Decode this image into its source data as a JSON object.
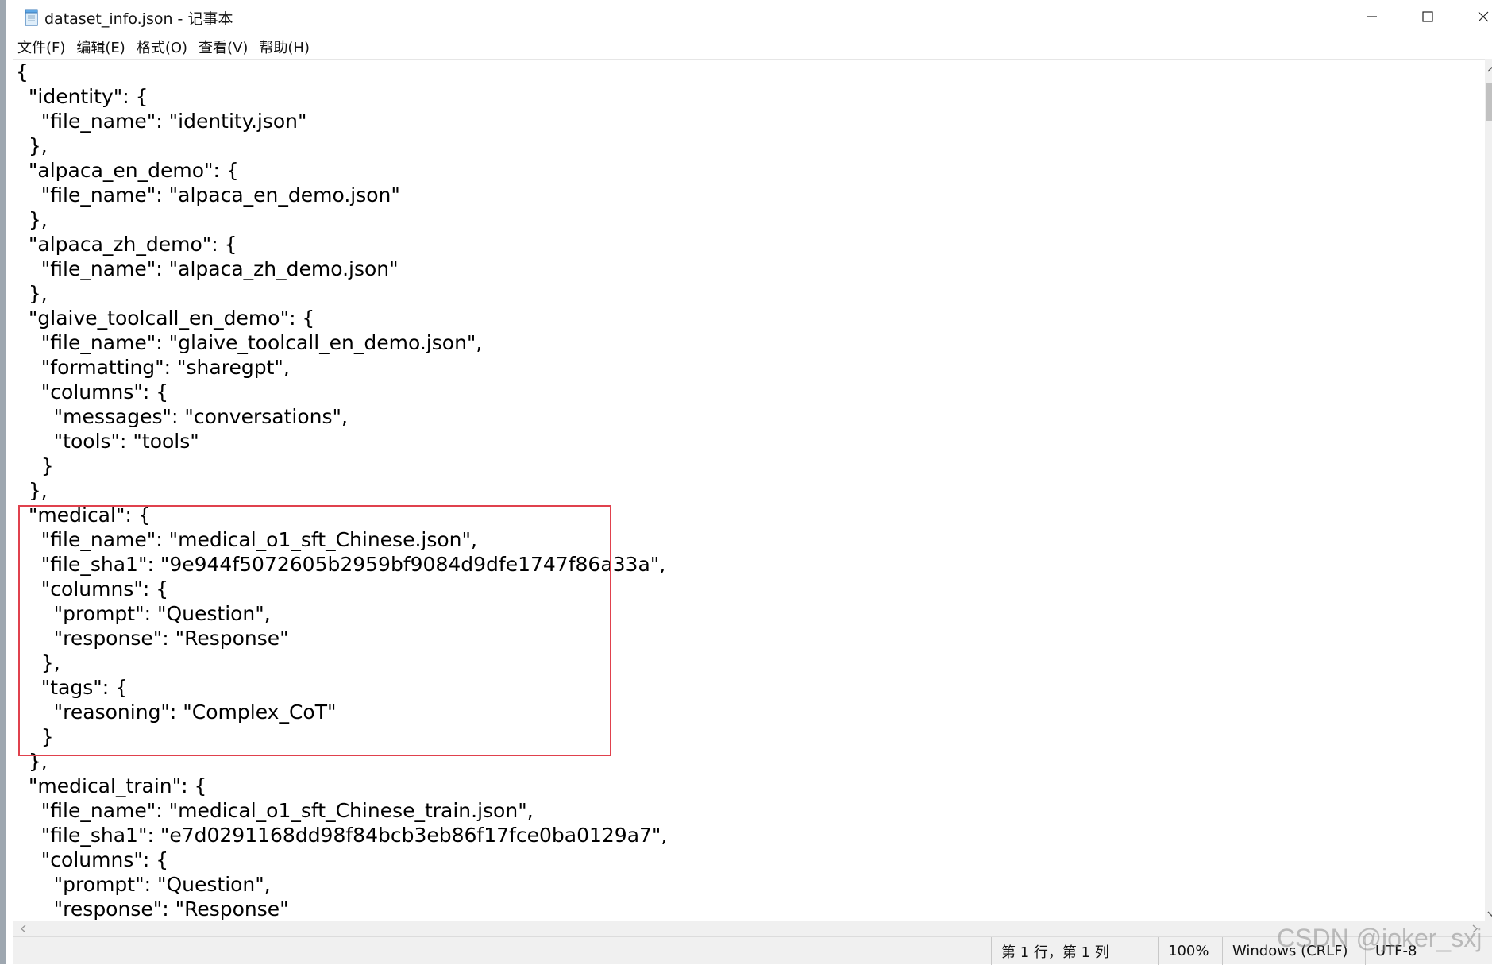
{
  "window": {
    "title": "dataset_info.json - 记事本",
    "icon": "notepad-icon",
    "controls": [
      "minimize-icon",
      "maximize-icon",
      "close-icon"
    ]
  },
  "menu": {
    "items": [
      "文件(F)",
      "编辑(E)",
      "格式(O)",
      "查看(V)",
      "帮助(H)"
    ]
  },
  "editor": {
    "lines": [
      "{",
      "  \"identity\": {",
      "    \"file_name\": \"identity.json\"",
      "  },",
      "  \"alpaca_en_demo\": {",
      "    \"file_name\": \"alpaca_en_demo.json\"",
      "  },",
      "  \"alpaca_zh_demo\": {",
      "    \"file_name\": \"alpaca_zh_demo.json\"",
      "  },",
      "  \"glaive_toolcall_en_demo\": {",
      "    \"file_name\": \"glaive_toolcall_en_demo.json\",",
      "    \"formatting\": \"sharegpt\",",
      "    \"columns\": {",
      "      \"messages\": \"conversations\",",
      "      \"tools\": \"tools\"",
      "    }",
      "  },",
      "  \"medical\": {",
      "    \"file_name\": \"medical_o1_sft_Chinese.json\",",
      "    \"file_sha1\": \"9e944f5072605b2959bf9084d9dfe1747f86a33a\",",
      "    \"columns\": {",
      "      \"prompt\": \"Question\",",
      "      \"response\": \"Response\"",
      "    },",
      "    \"tags\": {",
      "      \"reasoning\": \"Complex_CoT\"",
      "    }",
      "  },",
      "  \"medical_train\": {",
      "    \"file_name\": \"medical_o1_sft_Chinese_train.json\",",
      "    \"file_sha1\": \"e7d0291168dd98f84bcb3eb86f17fce0ba0129a7\",",
      "    \"columns\": {",
      "      \"prompt\": \"Question\",",
      "      \"response\": \"Response\""
    ],
    "highlight_color": "#e0414d"
  },
  "status": {
    "position": "第 1 行，第 1 列",
    "zoom": "100%",
    "line_ending": "Windows (CRLF)",
    "encoding": "UTF-8"
  },
  "watermark": "CSDN @joker_sxj"
}
